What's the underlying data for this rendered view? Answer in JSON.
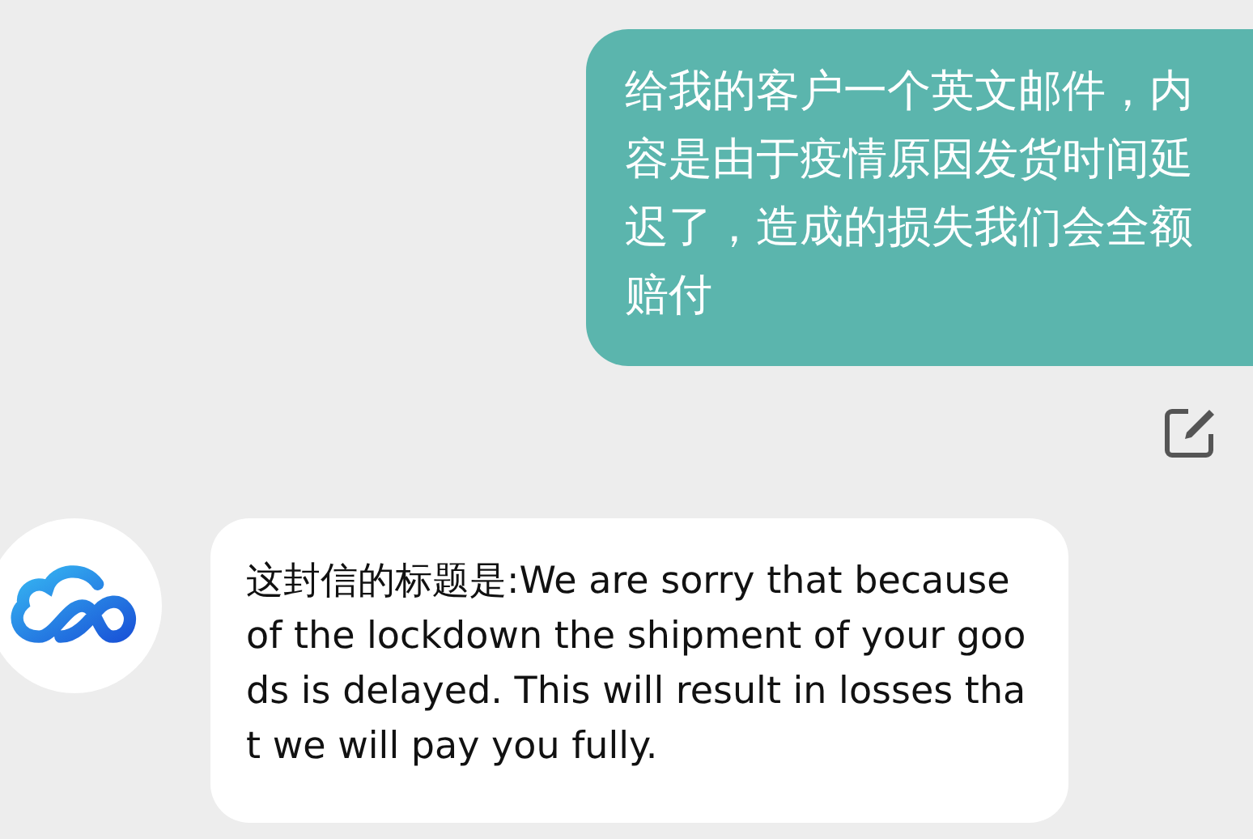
{
  "messages": [
    {
      "kind": "user",
      "text": "给我的客户一个英文邮件，内容是由于疫情原因发货时间延迟了，造成的损失我们会全额赔付"
    },
    {
      "kind": "bot",
      "text": "这封信的标题是:We are sorry that because of the lockdown the shipment of your goods is delayed. This will result in losses that we will pay you fully."
    }
  ]
}
